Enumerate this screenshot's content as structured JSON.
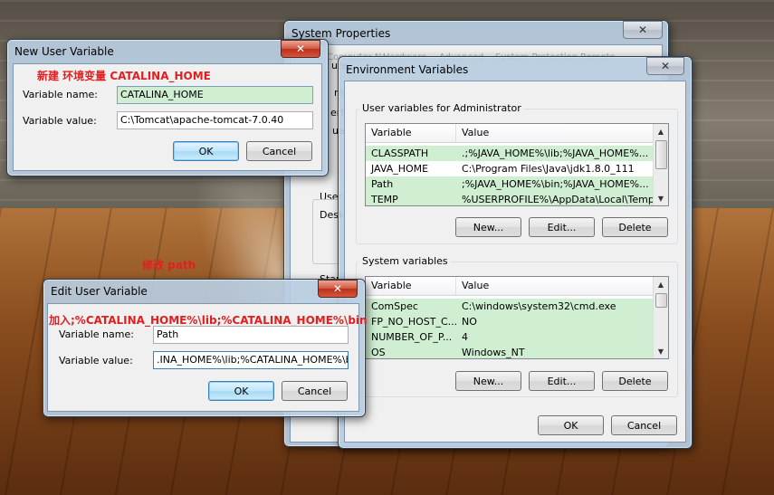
{
  "annotations": {
    "create_var": "新建 环境变量  CATALINA_HOME",
    "edit_path": "修改 path",
    "append_text": "加入;%CATALINA_HOME%\\lib;%CATALINA_HOME%\\bin"
  },
  "system_properties": {
    "title": "System Properties",
    "tabs": [
      "Computer Name",
      "Hardware",
      "Advanced",
      "System Protection",
      "Remote"
    ],
    "partial_labels": [
      "ute",
      "m",
      "erfo",
      "ual",
      "User",
      "Desk",
      "Star"
    ]
  },
  "new_user_variable": {
    "title": "New User Variable",
    "name_label": "Variable name:",
    "name_value": "CATALINA_HOME",
    "value_label": "Variable value:",
    "value_value": "C:\\Tomcat\\apache-tomcat-7.0.40",
    "ok": "OK",
    "cancel": "Cancel"
  },
  "edit_user_variable": {
    "title": "Edit User Variable",
    "name_label": "Variable name:",
    "name_value": "Path",
    "value_label": "Variable value:",
    "value_value": ".INA_HOME%\\lib;%CATALINA_HOME%\\bin",
    "ok": "OK",
    "cancel": "Cancel"
  },
  "environment_variables": {
    "title": "Environment Variables",
    "user_group_title": "User variables for Administrator",
    "system_group_title": "System variables",
    "col_variable": "Variable",
    "col_value": "Value",
    "user_rows": [
      {
        "name": "CLASSPATH",
        "value": ".;%JAVA_HOME%\\lib;%JAVA_HOME%..."
      },
      {
        "name": "JAVA_HOME",
        "value": "C:\\Program Files\\Java\\jdk1.8.0_111"
      },
      {
        "name": "Path",
        "value": ";%JAVA_HOME%\\bin;%JAVA_HOME%..."
      },
      {
        "name": "TEMP",
        "value": "%USERPROFILE%\\AppData\\Local\\Temp"
      }
    ],
    "system_rows": [
      {
        "name": "ComSpec",
        "value": "C:\\windows\\system32\\cmd.exe"
      },
      {
        "name": "FP_NO_HOST_C...",
        "value": "NO"
      },
      {
        "name": "NUMBER_OF_P...",
        "value": "4"
      },
      {
        "name": "OS",
        "value": "Windows_NT"
      }
    ],
    "new": "New...",
    "edit": "Edit...",
    "delete": "Delete",
    "ok": "OK",
    "cancel": "Cancel"
  },
  "icons": {
    "close": "close-icon",
    "scroll_up": "scroll-up-icon",
    "scroll_down": "scroll-down-icon"
  },
  "colors": {
    "selection": "#cfeed2",
    "close_red": "#d65a40",
    "annotation": "#e02020"
  }
}
